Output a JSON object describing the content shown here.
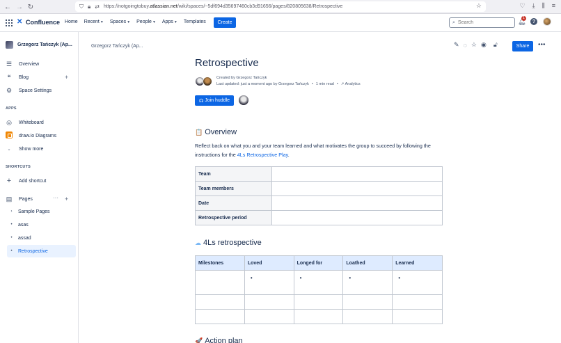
{
  "browser": {
    "url_prefix": "https://notgoingtobuy.",
    "url_domain": "atlassian.net",
    "url_path": "/wiki/spaces/~5df694d35697460cb3d91656/pages/820805638/Retrospective"
  },
  "header": {
    "product": "Confluence",
    "nav": [
      "Home",
      "Recent",
      "Spaces",
      "People",
      "Apps",
      "Templates"
    ],
    "create_label": "Create",
    "search_placeholder": "Search",
    "notification_count": "1",
    "help_label": "?"
  },
  "sidebar": {
    "space_name": "Grzegorz Tańczyk (Ap...",
    "items": {
      "overview": "Overview",
      "blog": "Blog",
      "space_settings": "Space Settings"
    },
    "apps_heading": "APPS",
    "apps": {
      "whiteboard": "Whiteboard",
      "drawio": "draw.io Diagrams",
      "show_more": "Show more"
    },
    "shortcuts_heading": "SHORTCUTS",
    "add_shortcut": "Add shortcut",
    "pages_label": "Pages",
    "pages": [
      "Sample Pages",
      "asas",
      "assad",
      "Retrospective"
    ]
  },
  "page": {
    "breadcrumb": "Grzegorz Tańczyk (Ap...",
    "share_label": "Share",
    "title": "Retrospective",
    "created_by": "Created by Grzegorz Tańczyk",
    "last_updated": "Last updated: just a moment ago by Grzegorz Tańczyk",
    "read_time": "1 min read",
    "analytics": "Analytics",
    "join_huddle": "Join huddle",
    "overview_heading": "Overview",
    "intro_text": "Reflect back on what you and your team learned and what motivates the group to succeed by following the instructions for the ",
    "intro_link": "4Ls Retrospective Play",
    "intro_end": ".",
    "table1_rows": [
      "Team",
      "Team members",
      "Date",
      "Retrospective period"
    ],
    "fourls_heading": "4Ls retrospective",
    "table2_headers": [
      "Milestones",
      "Loved",
      "Longed for",
      "Loathed",
      "Learned"
    ],
    "bullet": "•",
    "action_heading": "Action plan"
  },
  "colors": {
    "brand_blue": "#0c66e4",
    "notification_red": "#c9372c",
    "table_header_blue": "#deebff"
  }
}
